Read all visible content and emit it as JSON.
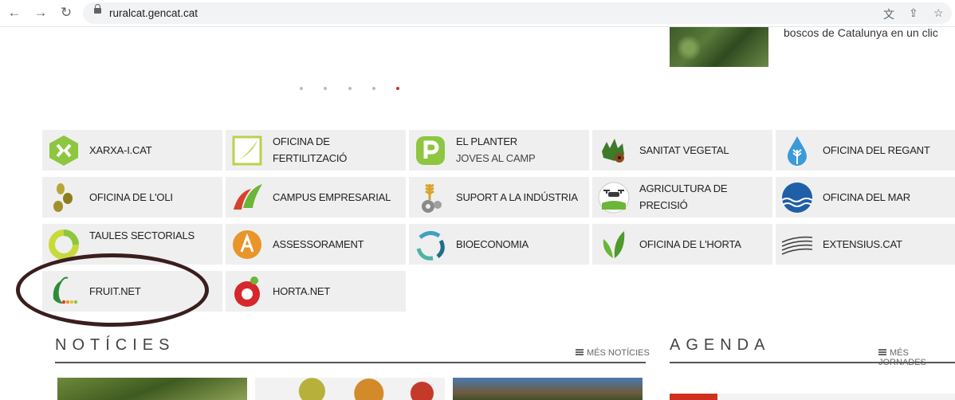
{
  "browser": {
    "url": "ruralcat.gencat.cat",
    "back_icon": "←",
    "forward_icon": "→",
    "reload_icon": "↻",
    "star_icon": "☆",
    "share_icon": "⇪",
    "translate_icon": "文"
  },
  "hero": {
    "caption": "boscos de Catalunya en un clic"
  },
  "carousel": {
    "dot_count": 5,
    "active_index": 4,
    "active_color": "#c0392b"
  },
  "tiles": [
    {
      "line1": "XARXA-I.CAT",
      "line2": ""
    },
    {
      "line1": "OFICINA DE",
      "line2": "FERTILITZACIÓ"
    },
    {
      "line1": "EL PLANTER",
      "line2": "JOVES AL CAMP"
    },
    {
      "line1": "SANITAT VEGETAL",
      "line2": ""
    },
    {
      "line1": "OFICINA DEL REGANT",
      "line2": ""
    },
    {
      "line1": "OFICINA DE L'OLI",
      "line2": ""
    },
    {
      "line1": "CAMPUS EMPRESARIAL",
      "line2": ""
    },
    {
      "line1": "SUPORT A LA INDÚSTRIA",
      "line2": ""
    },
    {
      "line1": "AGRICULTURA DE",
      "line2": "PRECISIÓ"
    },
    {
      "line1": "OFICINA DEL MAR",
      "line2": ""
    },
    {
      "line1": "TAULES SECTORIALS",
      "line2": ""
    },
    {
      "line1": "ASSESSORAMENT",
      "line2": ""
    },
    {
      "line1": "BIOECONOMIA",
      "line2": ""
    },
    {
      "line1": "OFICINA DE L'HORTA",
      "line2": ""
    },
    {
      "line1": "EXTENSIUS.CAT",
      "line2": ""
    },
    {
      "line1": "FRUIT.NET",
      "line2": ""
    },
    {
      "line1": "HORTA.NET",
      "line2": ""
    }
  ],
  "news": {
    "title": "NOTÍCIES",
    "more_label": "MÉS NOTÍCIES"
  },
  "agenda": {
    "title": "AGENDA",
    "more_label": "MÉS JORNADES"
  },
  "colors": {
    "highlight_oval": "#3a1e1e",
    "accent_red": "#d0301e",
    "tile_bg": "#efefef"
  }
}
